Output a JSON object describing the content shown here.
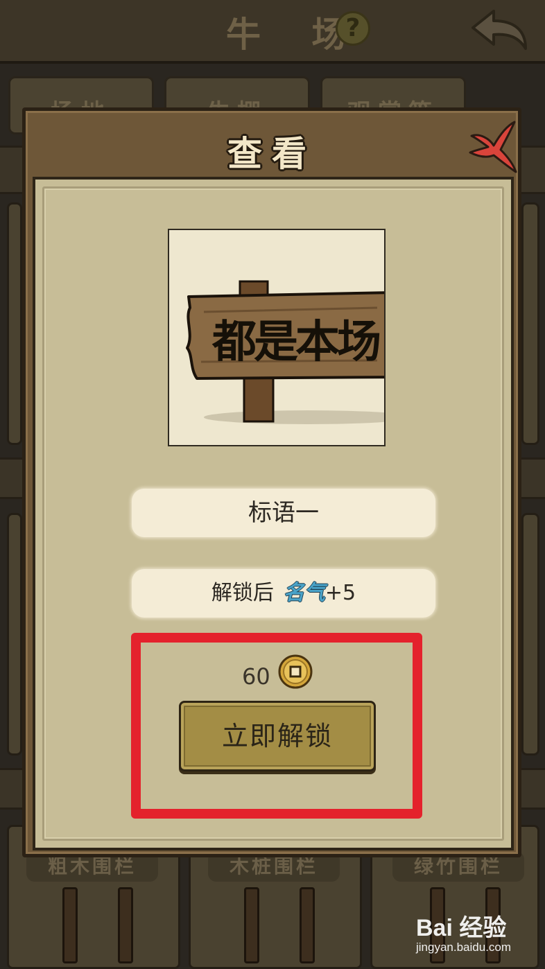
{
  "header": {
    "title": "牛 场",
    "help_icon_text": "?"
  },
  "background_tabs": [
    "场地",
    "牛棚",
    "观赏等"
  ],
  "background_items": [
    "粗木围栏",
    "木桩围栏",
    "绿竹围栏"
  ],
  "dialog": {
    "title": "查看",
    "preview_sign_text": "都是本场",
    "item_name": "标语一",
    "reward_prefix": "解锁后",
    "reward_stat": "名气",
    "reward_value": "+5",
    "price": "60",
    "unlock_button": "立即解锁"
  },
  "watermark": {
    "logo": "Bai 经验",
    "url": "jingyan.baidu.com"
  },
  "colors": {
    "highlight": "#e4222c",
    "panel": "#c7bd97",
    "button": "#a38d45",
    "close": "#d9443b"
  }
}
